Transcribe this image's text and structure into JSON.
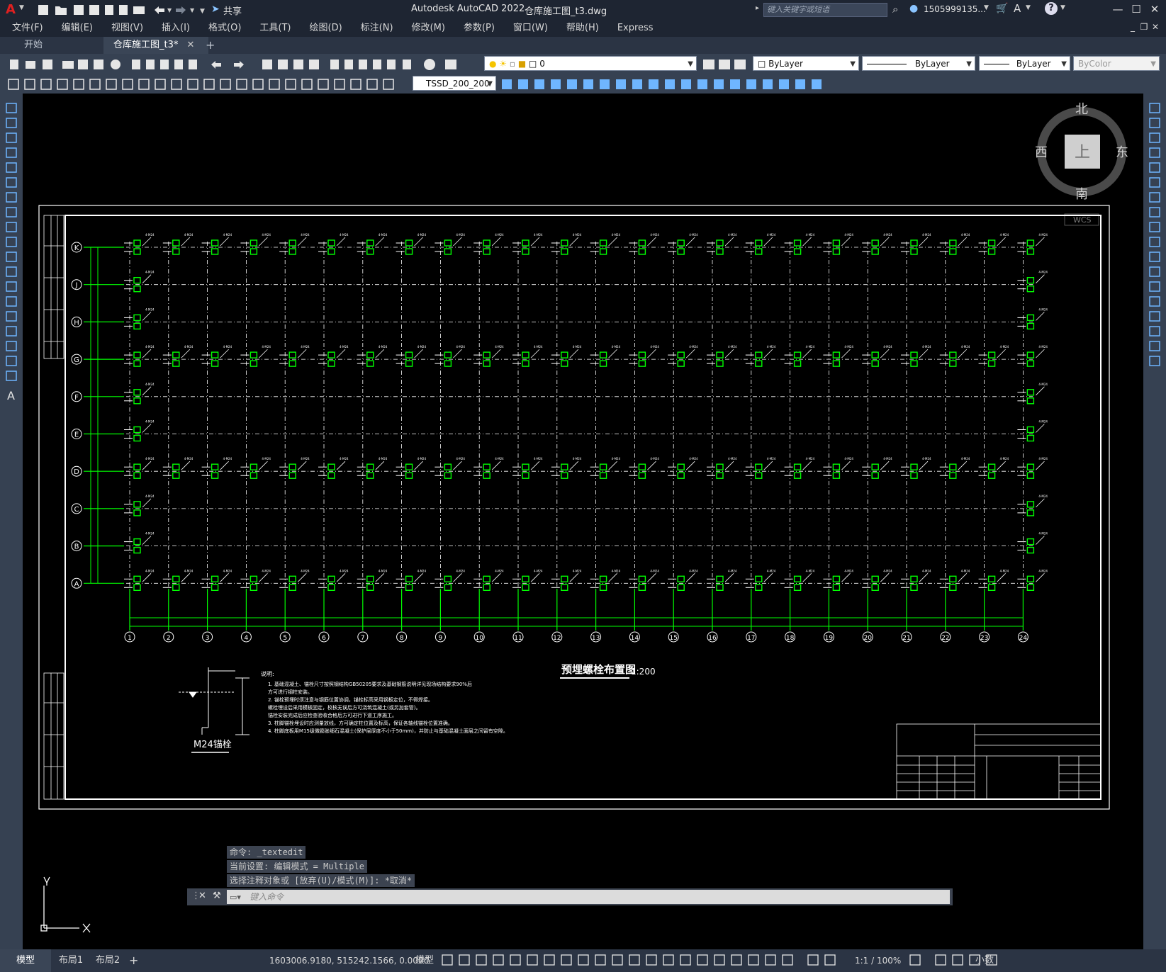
{
  "titlebar": {
    "app_title": "Autodesk AutoCAD 2022",
    "file_name": "仓库施工图_t3.dwg",
    "share_label": "共享",
    "search_placeholder": "键入关键字或短语",
    "user": "1505999135...",
    "icons": [
      "autocad-logo-icon",
      "new-icon",
      "open-icon",
      "save-icon",
      "saveas-icon",
      "plot-icon",
      "undo-icon",
      "redo-icon",
      "share-icon",
      "search-icon",
      "user-icon",
      "cart-icon",
      "help-icon",
      "minimize-icon",
      "maximize-icon",
      "close-icon"
    ]
  },
  "menubar": [
    "文件(F)",
    "编辑(E)",
    "视图(V)",
    "插入(I)",
    "格式(O)",
    "工具(T)",
    "绘图(D)",
    "标注(N)",
    "修改(M)",
    "参数(P)",
    "窗口(W)",
    "帮助(H)",
    "Express"
  ],
  "tabs": [
    {
      "label": "开始"
    },
    {
      "label": "仓库施工图_t3*"
    }
  ],
  "toolbar1": {
    "layer_value": "0",
    "color_value": "ByLayer",
    "linetype_value": "ByLayer",
    "lineweight_value": "ByLayer",
    "plotstyle_value": "ByColor"
  },
  "toolbar2": {
    "style_value": "TSSD_200_200"
  },
  "viewcube": {
    "north": "北",
    "south": "南",
    "east": "东",
    "west": "西",
    "top": "上",
    "wcs": "WCS"
  },
  "drawing": {
    "title": "预埋螺栓布置图",
    "scale": "1:200",
    "detail_label": "M24锚栓",
    "notes_heading": "说明:",
    "notes": [
      "1. 基础混凝土、锚栓尺寸按照钢结构GB50205要求及基础钢筋说明详见现场结构要求90%后",
      "   方可进行钢柱安装。",
      "2. 锚栓预埋时须注意与钢筋位置协调，锚栓标高采用钢板定位，不得焊接。",
      "   螺栓埋设后采用模板固定，校核无误后方可浇筑混凝土(或另加套管)。",
      "   锚栓安装完成后应检查验收合格后方可进行下道工序施工。",
      "3. 柱脚锚栓埋设时应测量放线，方可确定柱位置及标高，保证各轴线锚栓位置准确。",
      "4. 柱脚底板用M15级微膨胀细石混凝土(保护层厚度不小于50mm)，并防止与基础混凝土面层之间留有空隙。"
    ],
    "row_axes": [
      "K",
      "J",
      "H",
      "G",
      "F",
      "E",
      "D",
      "C",
      "B",
      "A"
    ],
    "col_axes": [
      "1",
      "2",
      "3",
      "4",
      "5",
      "6",
      "7",
      "8",
      "9",
      "10",
      "11",
      "12",
      "13",
      "14",
      "15",
      "16",
      "17",
      "18",
      "19",
      "20",
      "21",
      "22",
      "23",
      "24"
    ],
    "bolt_label": "4-M24"
  },
  "command": {
    "history": [
      "命令: _textedit",
      "当前设置: 编辑模式 = Multiple",
      "选择注释对象或 [放弃(U)/模式(M)]: *取消*"
    ],
    "input_placeholder": "键入命令"
  },
  "ucs": {
    "x": "X",
    "y": "Y"
  },
  "statusbar": {
    "layout_tabs": [
      "模型",
      "布局1",
      "布局2"
    ],
    "coords": "1603006.9180, 515242.1566, 0.0000",
    "mode": "模型",
    "scale": "1:1 / 100%",
    "units": "小数"
  },
  "colors": {
    "chrome": "#364152",
    "titlebar": "#1e2532",
    "canvas": "#000000",
    "bolt_green": "#00ff00",
    "line_white": "#ffffff"
  }
}
